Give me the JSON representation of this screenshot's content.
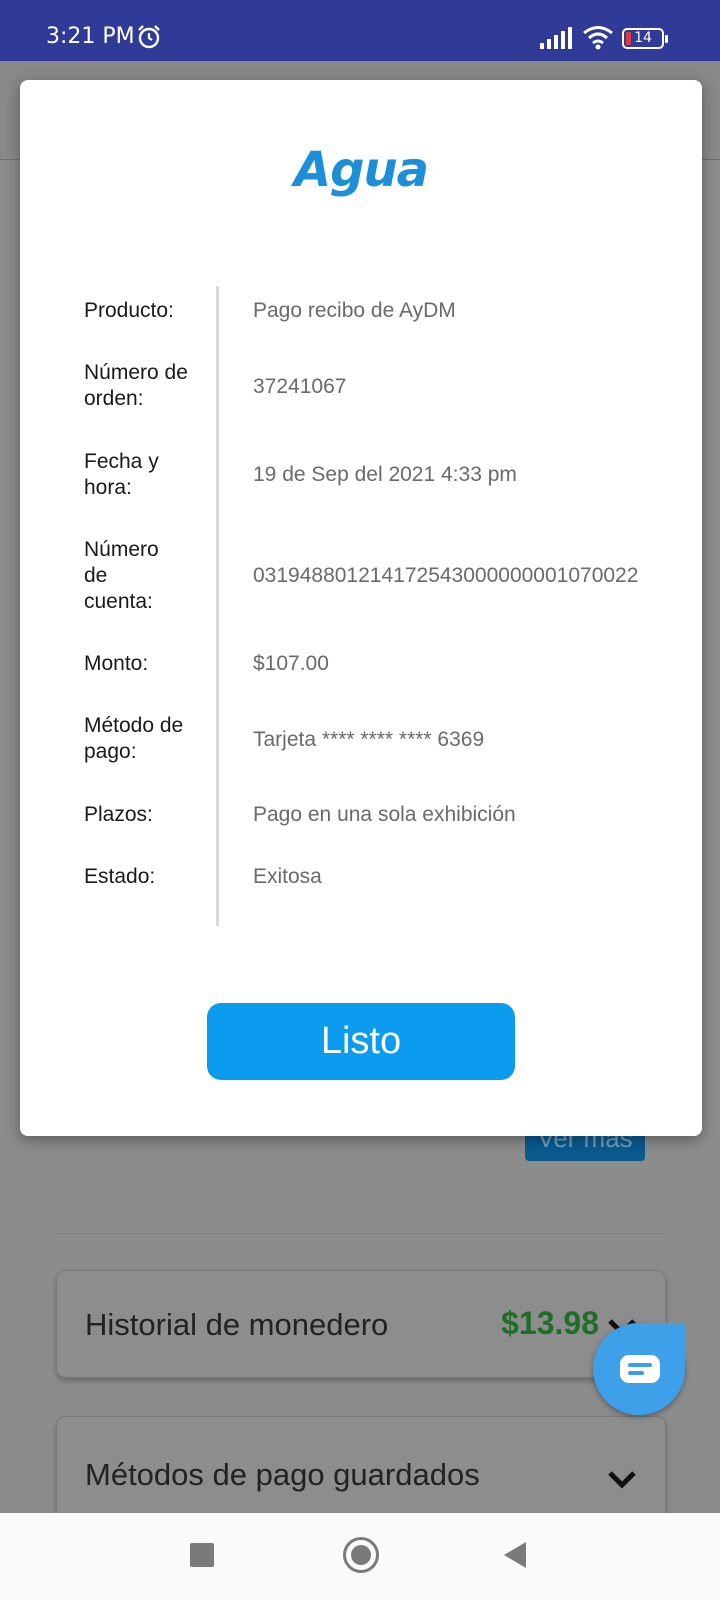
{
  "status_bar": {
    "time": "3:21 PM",
    "battery": "14"
  },
  "background": {
    "ver_mas": "Ver más",
    "wallet_title": "Historial de monedero",
    "wallet_amount": "$13.98",
    "methods_title": "Métodos de pago guardados"
  },
  "modal": {
    "logo": "Agua",
    "rows": [
      {
        "label": "Producto:",
        "value": "Pago recibo de AyDM"
      },
      {
        "label": "Número de orden:",
        "value": "37241067"
      },
      {
        "label": "Fecha y hora:",
        "value": "19 de Sep del 2021 4:33 pm"
      },
      {
        "label": "Número de cuenta:",
        "value": "031948801214172543000000001070022"
      },
      {
        "label": "Monto:",
        "value": "$107.00"
      },
      {
        "label": "Método de pago:",
        "value": "Tarjeta **** **** **** 6369"
      },
      {
        "label": "Plazos:",
        "value": "Pago en una sola exhibición"
      },
      {
        "label": "Estado:",
        "value": "Exitosa"
      }
    ],
    "button_label": "Listo"
  },
  "colors": {
    "accent": "#0b9bef",
    "status_bar": "#2f3b96",
    "amount_green": "#1e6e2a"
  }
}
